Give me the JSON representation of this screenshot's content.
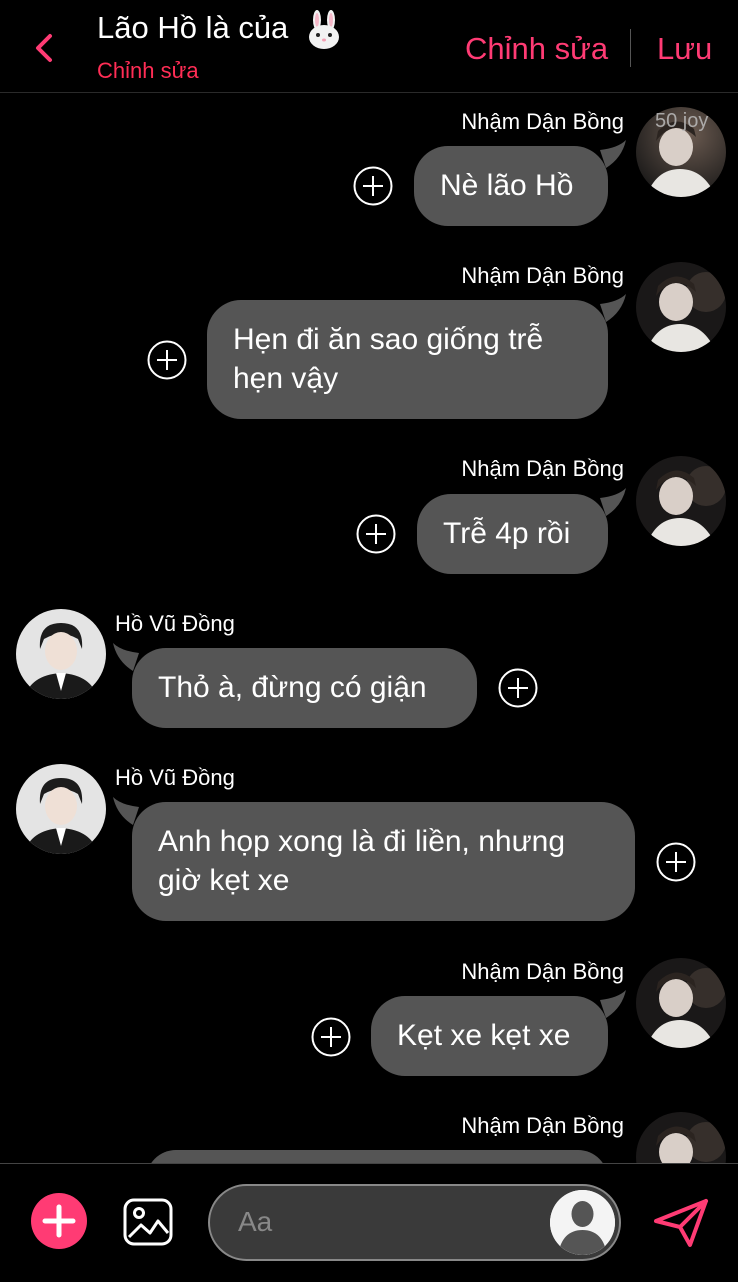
{
  "header": {
    "title": "Lão Hồ là của",
    "subtitle": "Chỉnh sửa",
    "edit_label": "Chỉnh sửa",
    "save_label": "Lưu"
  },
  "badge": "50 joy",
  "messages": [
    {
      "sender": "Nhậm Dận Bồng",
      "text": "Nè lão Hồ",
      "side": "right"
    },
    {
      "sender": "Nhậm Dận Bồng",
      "text": "Hẹn đi ăn sao giống trễ hẹn vậy",
      "side": "right"
    },
    {
      "sender": "Nhậm Dận Bồng",
      "text": "Trễ 4p rồi",
      "side": "right"
    },
    {
      "sender": "Hồ Vũ Đồng",
      "text": "Thỏ à, đừng có giận",
      "side": "left"
    },
    {
      "sender": "Hồ Vũ Đồng",
      "text": "Anh họp xong là đi liền, nhưng giờ kẹt xe",
      "side": "left"
    },
    {
      "sender": "Nhậm Dận Bồng",
      "text": "Kẹt xe kẹt xe",
      "side": "right"
    },
    {
      "sender": "Nhậm Dận Bồng",
      "text": "",
      "side": "right"
    }
  ],
  "composer": {
    "placeholder": "Aa"
  },
  "colors": {
    "accent": "#ff3b74",
    "subtitle": "#ff2d55",
    "bubble": "#555555",
    "background": "#000000"
  }
}
